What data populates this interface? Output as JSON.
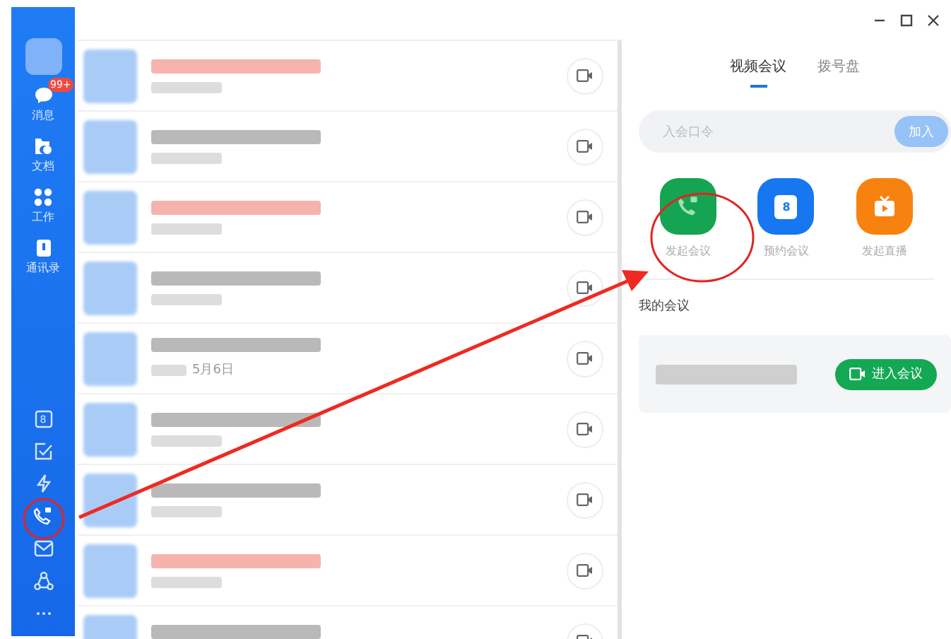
{
  "sidebar": {
    "nav": [
      {
        "label": "消息",
        "kind": "chat",
        "badge": "99+"
      },
      {
        "label": "文档",
        "kind": "docs"
      },
      {
        "label": "工作",
        "kind": "apps"
      },
      {
        "label": "通讯录",
        "kind": "contacts"
      }
    ],
    "tools": [
      {
        "kind": "calendar",
        "text": "8"
      },
      {
        "kind": "todo"
      },
      {
        "kind": "flash"
      },
      {
        "kind": "call"
      },
      {
        "kind": "mail"
      },
      {
        "kind": "team"
      },
      {
        "kind": "more"
      }
    ]
  },
  "chat_list": {
    "rows": [
      {
        "color": "#f6b3ad"
      },
      {
        "color": "#b9b9b9"
      },
      {
        "color": "#f6b3ad"
      },
      {
        "color": "#b9b9b9"
      },
      {
        "color": "#b9b9b9",
        "date": "5月6日"
      },
      {
        "color": "#b9b9b9"
      },
      {
        "color": "#b9b9b9"
      },
      {
        "color": "#f6b3ad"
      },
      {
        "color": "#b9b9b9"
      }
    ]
  },
  "meeting_panel": {
    "tabs": [
      {
        "label": "视频会议",
        "selected": true
      },
      {
        "label": "拨号盘",
        "selected": false
      }
    ],
    "join": {
      "placeholder": "入会口令",
      "button": "加入"
    },
    "actions": [
      {
        "label": "发起会议",
        "kind": "call"
      },
      {
        "label": "预约会议",
        "kind": "schedule",
        "icon_text": "8"
      },
      {
        "label": "发起直播",
        "kind": "live"
      }
    ],
    "my_meetings": {
      "title": "我的会议",
      "button": "进入会议"
    }
  },
  "annotations": [
    {
      "kind": "circle"
    },
    {
      "kind": "arrow"
    },
    {
      "kind": "circle"
    }
  ]
}
